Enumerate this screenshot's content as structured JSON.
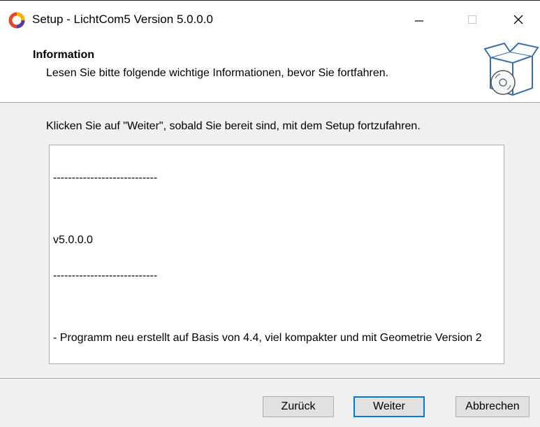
{
  "window": {
    "title": "Setup - LichtCom5 Version 5.0.0.0",
    "minimize_glyph": "—",
    "maximize_glyph": "☐",
    "close_glyph": "✕"
  },
  "header": {
    "title": "Information",
    "subtitle": "Lesen Sie bitte folgende wichtige Informationen, bevor Sie fortfahren.",
    "icon": "setup-box-cd-icon"
  },
  "main": {
    "instruction": "Klicken Sie auf \"Weiter\", sobald Sie bereit sind, mit dem Setup fortzufahren.",
    "memo_lines": [
      "----------------------------",
      "v5.0.0.0",
      "----------------------------",
      "- Programm neu erstellt auf Basis von 4.4, viel kompakter und mit Geometrie Version 2"
    ]
  },
  "buttons": {
    "back": "Zurück",
    "next": "Weiter",
    "cancel": "Abbrechen"
  },
  "colors": {
    "accent": "#0078d7",
    "window_bg": "#f0f0f0"
  }
}
